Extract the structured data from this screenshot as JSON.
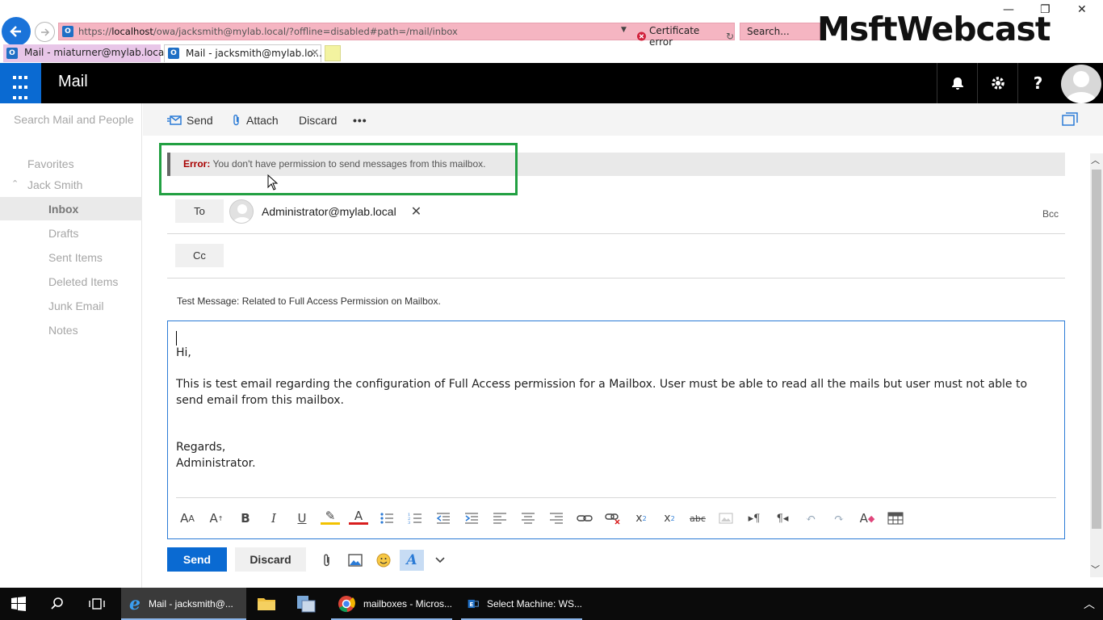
{
  "browser": {
    "url_prefix": "https://",
    "url_host": "localhost",
    "url_path": "/owa/jacksmith@mylab.local/?offline=disabled#path=/mail/inbox",
    "cert_error": "Certificate error",
    "search_placeholder": "Search...",
    "tabs": [
      {
        "label": "Mail - miaturner@mylab.local"
      },
      {
        "label": "Mail - jacksmith@mylab.lo..."
      }
    ],
    "watermark": "MsftWebcast"
  },
  "owa": {
    "app_title": "Mail",
    "search_placeholder": "Search Mail and People"
  },
  "sidebar": {
    "favorites": "Favorites",
    "account": "Jack Smith",
    "folders": [
      "Inbox",
      "Drafts",
      "Sent Items",
      "Deleted Items",
      "Junk Email",
      "Notes"
    ]
  },
  "toolbar": {
    "send": "Send",
    "attach": "Attach",
    "discard": "Discard",
    "more": "•••"
  },
  "compose": {
    "error_label": "Error:",
    "error_text": " You don't have permission to send messages from this mailbox.",
    "to_label": "To",
    "cc_label": "Cc",
    "bcc_label": "Bcc",
    "recipient": "Administrator@mylab.local",
    "subject": "Test Message: Related to Full Access Permission on Mailbox.",
    "body": "Hi,\n\nThis is test email regarding the configuration of Full Access permission for a Mailbox. User must be able to read all the mails but user must not able to send email from this mailbox.\n\n\nRegards,\nAdministrator.",
    "send_button": "Send",
    "discard_button": "Discard"
  },
  "taskbar": {
    "items": [
      {
        "label": "Mail - jacksmith@..."
      },
      {
        "label": "mailboxes - Micros..."
      },
      {
        "label": "Select Machine: WS..."
      }
    ]
  },
  "colors": {
    "accent": "#0a6ad2",
    "error": "#a80000",
    "highlight_box": "#22a042",
    "address_bar": "#f5b5c2"
  }
}
